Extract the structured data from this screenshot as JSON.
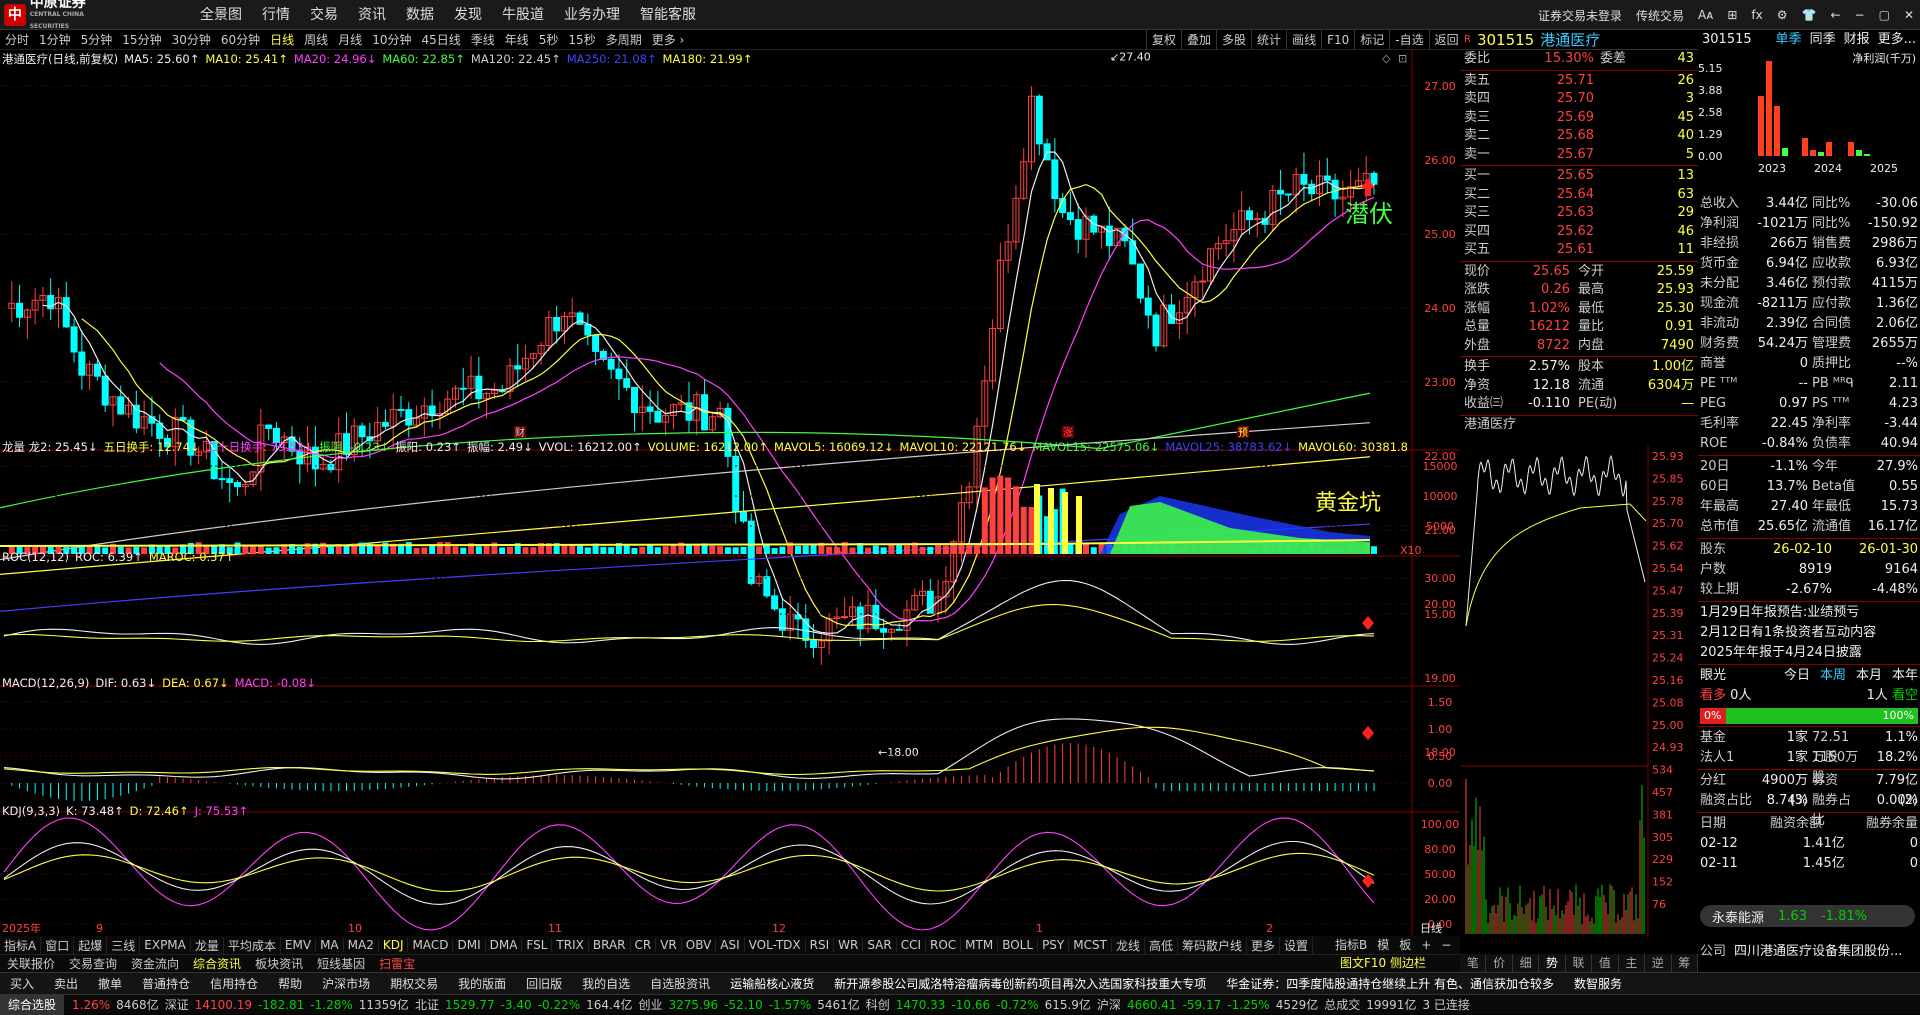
{
  "app": {
    "logo": "中原证券",
    "logo_sub": "CENTRAL CHINA SECURITIES",
    "menu": [
      "全景图",
      "行情",
      "交易",
      "资讯",
      "数据",
      "发现",
      "牛股道",
      "业务办理",
      "智能客服"
    ],
    "right": [
      "证券交易未登录",
      "传统交易",
      "Aᴀ",
      "⊞",
      "fx",
      "⚙",
      "👕",
      "←",
      "−",
      "▢",
      "✕"
    ]
  },
  "toolbar": {
    "periods": [
      "分时",
      "1分钟",
      "5分钟",
      "15分钟",
      "30分钟",
      "60分钟",
      "日线",
      "周线",
      "月线",
      "10分钟",
      "45日线",
      "季线",
      "年线",
      "5秒",
      "15秒",
      "多周期",
      "更多 ›"
    ],
    "active": "日线",
    "right": [
      "复权",
      "叠加",
      "多股",
      "统计",
      "画线",
      "F10",
      "标记",
      "-自选",
      "返回"
    ]
  },
  "chart": {
    "title": "港通医疗(日线,前复权)",
    "ma": [
      {
        "label": "MA5: 25.60↑",
        "color": "#eeeeee"
      },
      {
        "label": "MA10: 25.41↑",
        "color": "#ffff40"
      },
      {
        "label": "MA20: 24.96↓",
        "color": "#ff40ff"
      },
      {
        "label": "MA60: 22.85↑",
        "color": "#40ff40"
      },
      {
        "label": "MA120: 22.45↑",
        "color": "#cccccc"
      },
      {
        "label": "MA250: 21.08↑",
        "color": "#4040ff"
      },
      {
        "label": "MA180: 21.99↑",
        "color": "#ffff40"
      }
    ],
    "yticks": [
      "27.00",
      "26.00",
      "25.00",
      "24.00",
      "23.00",
      "22.00",
      "21.00",
      "20.00",
      "19.00",
      "18.00"
    ],
    "high_label": "27.40",
    "low_label": "18.00",
    "annot_qianfu": "潜伏",
    "annot_gold": "黄金坑",
    "markers": [
      "财",
      "涨",
      "预"
    ],
    "months": [
      "2025年",
      "9",
      "10",
      "11",
      "12",
      "1",
      "2"
    ],
    "period_label": "日线"
  },
  "vol": {
    "legend": [
      {
        "t": "龙量 龙2: 25.45↓",
        "c": "#eeeeee"
      },
      {
        "t": "五日换手: 12.74↓",
        "c": "#ffff40"
      },
      {
        "t": "二十日换手: 79.53↓",
        "c": "#ff40ff"
      },
      {
        "t": "振阴: -0.23↓",
        "c": "#40ff40"
      },
      {
        "t": "振阳: 0.23↑",
        "c": "#eeeeee"
      },
      {
        "t": "振幅: 2.49↓",
        "c": "#eeeeee"
      },
      {
        "t": "VVOL: 16212.00↑",
        "c": "#eeeeee"
      },
      {
        "t": "VOLUME: 16212.00↑",
        "c": "#ffff40"
      },
      {
        "t": "MAVOL5: 16069.12↓",
        "c": "#ffff40"
      },
      {
        "t": "MAVOL10: 22121.76↓",
        "c": "#ffff40"
      },
      {
        "t": "MAVOL15: 22575.06↓",
        "c": "#40ff40"
      },
      {
        "t": "MAVOL25: 38783.62↓",
        "c": "#4040ff"
      },
      {
        "t": "MAVOL60: 30381.8",
        "c": "#ffff40"
      }
    ],
    "yticks": [
      "15000",
      "10000",
      "5000"
    ],
    "unit": "X10"
  },
  "roc": {
    "legend": [
      {
        "t": "ROC(12,12)",
        "c": "#eeeeee"
      },
      {
        "t": "ROC: 6.39↑",
        "c": "#eeeeee"
      },
      {
        "t": "MAROC: 0.37↑",
        "c": "#ffff40"
      }
    ],
    "yticks": [
      "30.00",
      "15.00"
    ]
  },
  "macd": {
    "legend": [
      {
        "t": "MACD(12,26,9)",
        "c": "#eeeeee"
      },
      {
        "t": "DIF: 0.63↓",
        "c": "#eeeeee"
      },
      {
        "t": "DEA: 0.67↓",
        "c": "#ffff40"
      },
      {
        "t": "MACD: -0.08↓",
        "c": "#ff40ff"
      }
    ],
    "yticks": [
      "1.50",
      "1.00",
      "0.50",
      "0.00"
    ]
  },
  "kdj": {
    "legend": [
      {
        "t": "KDJ(9,3,3)",
        "c": "#eeeeee"
      },
      {
        "t": "K: 73.48↑",
        "c": "#eeeeee"
      },
      {
        "t": "D: 72.46↑",
        "c": "#ffff40"
      },
      {
        "t": "J: 75.53↑",
        "c": "#ff40ff"
      }
    ],
    "yticks": [
      "100.00",
      "80.00",
      "50.00",
      "20.00",
      "0.00"
    ]
  },
  "quote": {
    "code": "301515",
    "name": "港通医疗",
    "webi": "15.30%",
    "weicha": "43",
    "sells": [
      {
        "l": "卖五",
        "p": "25.71",
        "v": "26"
      },
      {
        "l": "卖四",
        "p": "25.70",
        "v": "3"
      },
      {
        "l": "卖三",
        "p": "25.69",
        "v": "45"
      },
      {
        "l": "卖二",
        "p": "25.68",
        "v": "40"
      },
      {
        "l": "卖一",
        "p": "25.67",
        "v": "5"
      }
    ],
    "buys": [
      {
        "l": "买一",
        "p": "25.65",
        "v": "13"
      },
      {
        "l": "买二",
        "p": "25.64",
        "v": "63"
      },
      {
        "l": "买三",
        "p": "25.63",
        "v": "29"
      },
      {
        "l": "买四",
        "p": "25.62",
        "v": "46"
      },
      {
        "l": "买五",
        "p": "25.61",
        "v": "11"
      }
    ],
    "stats": [
      [
        "现价",
        "25.65",
        "今开",
        "25.59"
      ],
      [
        "涨跌",
        "0.26",
        "最高",
        "25.93"
      ],
      [
        "涨幅",
        "1.02%",
        "最低",
        "25.30"
      ],
      [
        "总量",
        "16212",
        "量比",
        "0.91"
      ],
      [
        "外盘",
        "8722",
        "内盘",
        "7490"
      ]
    ],
    "stats2": [
      [
        "换手",
        "2.57%",
        "股本",
        "1.00亿"
      ],
      [
        "净资",
        "12.18",
        "流通",
        "6304万"
      ],
      [
        "收益㈢",
        "-0.110",
        "PE(动)",
        "—"
      ]
    ],
    "mini_title": "港通医疗",
    "mini_ticks": [
      "25.93",
      "25.85",
      "25.78",
      "25.70",
      "25.62",
      "25.54",
      "25.47",
      "25.39",
      "25.31",
      "25.24",
      "25.16",
      "25.08",
      "25.00",
      "24.93",
      "534",
      "457",
      "381",
      "305",
      "229",
      "152",
      "76"
    ],
    "tabs": [
      "笔",
      "价",
      "细",
      "势",
      "联",
      "值",
      "主",
      "逆",
      "筹"
    ]
  },
  "fin": {
    "code": "301515",
    "tabs": [
      "单季",
      "同季",
      "财报",
      "更多..."
    ],
    "chart_title": "净利润(千万)",
    "chart_ticks": [
      "5.15",
      "3.88",
      "2.58",
      "1.29",
      "0.00"
    ],
    "years": [
      "2023",
      "2024",
      "2025"
    ],
    "rows": [
      [
        "总收入",
        "3.44亿",
        "同比%",
        "-30.06"
      ],
      [
        "净利润",
        "-1021万",
        "同比%",
        "-150.92"
      ],
      [
        "非经损",
        "266万",
        "销售费",
        "2986万"
      ],
      [
        "货币金",
        "6.94亿",
        "应收款",
        "6.93亿"
      ],
      [
        "未分配",
        "3.46亿",
        "预付款",
        "4115万"
      ],
      [
        "现金流",
        "-8211万",
        "应付款",
        "1.36亿"
      ],
      [
        "非流动",
        "2.39亿",
        "合同债",
        "2.06亿"
      ],
      [
        "财务费",
        "54.24万",
        "管理费",
        "2655万"
      ],
      [
        "商誉",
        "0",
        "质押比",
        "--%"
      ],
      [
        "PE ᵀᵀᴹ",
        "--",
        "PB ᴹᴿᑫ",
        "2.11"
      ],
      [
        "PEG",
        "0.97",
        "PS ᵀᵀᴹ",
        "4.23"
      ],
      [
        "毛利率",
        "22.45",
        "净利率",
        "-3.44"
      ],
      [
        "ROE",
        "-0.84%",
        "负债率",
        "40.94"
      ]
    ],
    "rows2": [
      [
        "20日",
        "-1.1%",
        "今年",
        "27.9%"
      ],
      [
        "60日",
        "13.7%",
        "Beta值",
        "0.55"
      ],
      [
        "年最高",
        "27.40",
        "年最低",
        "15.73"
      ],
      [
        "总市值",
        "25.65亿",
        "流通值",
        "16.17亿"
      ]
    ],
    "holders": [
      [
        "股东",
        "26-02-10",
        "26-01-30"
      ],
      [
        "户数",
        "8919",
        "9164"
      ],
      [
        "较上期",
        "-2.67%",
        "-4.48%"
      ]
    ],
    "news": [
      "1月29日年报预告:业绩预亏",
      "2月12日有1条投资者互动内容",
      "2025年年报于4月24日披露"
    ],
    "eye": {
      "label": "眼光",
      "tabs": [
        "今日",
        "本周",
        "本月",
        "本年"
      ],
      "bull": "看多",
      "bull_n": "0人",
      "bear_n": "1人",
      "bear": "看空",
      "pct_l": "0%",
      "pct_r": "100%"
    },
    "inst": [
      [
        "基金",
        "1家",
        "72.51万股",
        "1.1%"
      ],
      [
        "法人1",
        "1家",
        "1150万股",
        "18.2%"
      ]
    ],
    "div": [
      [
        "分红",
        "4900万(3)",
        "募资",
        "7.79亿(2)"
      ],
      [
        "融资占比",
        "8.74%",
        "融券占比",
        "0.00%"
      ]
    ],
    "margin_head": [
      "日期",
      "融资余额",
      "融券余量"
    ],
    "margin": [
      [
        "02-12",
        "1.41亿",
        "0"
      ],
      [
        "02-11",
        "1.45亿",
        "0"
      ]
    ],
    "float": {
      "name": "永泰能源",
      "price": "1.63",
      "chg": "-1.81%"
    },
    "company": [
      "公司",
      "四川港通医疗设备集团股份..."
    ]
  },
  "bottomtabs": [
    "指标A",
    "窗口",
    "起爆",
    "三线",
    "EXPMA",
    "龙量",
    "平均成本",
    "EMV",
    "MA",
    "MA2",
    "KDJ",
    "MACD",
    "DMI",
    "DMA",
    "FSL",
    "TRIX",
    "BRAR",
    "CR",
    "VR",
    "OBV",
    "ASI",
    "VOL-TDX",
    "RSI",
    "WR",
    "SAR",
    "CCI",
    "ROC",
    "MTM",
    "BOLL",
    "PSY",
    "MCST",
    "龙线",
    "高低",
    "筹码散户线",
    "更多",
    "设置"
  ],
  "bottomright": [
    "指标B",
    "模",
    "板",
    "+",
    "−"
  ],
  "navrow": [
    "关联报价",
    "交易查询",
    "资金流向",
    "综合资讯",
    "板块资讯",
    "短线基因",
    "扫雷宝"
  ],
  "nav_right": "图文F10 侧边栏",
  "actrow": [
    "买入",
    "卖出",
    "撤单",
    "普通持仓",
    "信用持仓",
    "帮助",
    "沪深市场",
    "期权交易",
    "我的版面",
    "回旧版",
    "我的自选",
    "自选股资讯",
    "运输船核心液货",
    "新开源参股公司威洛特溶瘤病毒创新药项目再次入选国家科技重大专项",
    "华金证券：四季度陆股通持仓继续上升 有色、通信获加仓较多",
    "数智服务"
  ],
  "status": {
    "label": "综合选股",
    "items": [
      {
        "t": "1.26%",
        "c": "#ff4040"
      },
      {
        "t": "8468亿",
        "c": "#ccc"
      },
      {
        "t": "深证",
        "c": "#ccc"
      },
      {
        "t": "14100.19",
        "c": "#ff4040"
      },
      {
        "t": "-182.81",
        "c": "#00d000"
      },
      {
        "t": "-1.28%",
        "c": "#00d000"
      },
      {
        "t": "11359亿",
        "c": "#ccc"
      },
      {
        "t": "北证",
        "c": "#ccc"
      },
      {
        "t": "1529.77",
        "c": "#00d000"
      },
      {
        "t": "-3.40",
        "c": "#00d000"
      },
      {
        "t": "-0.22%",
        "c": "#00d000"
      },
      {
        "t": "164.4亿",
        "c": "#ccc"
      },
      {
        "t": "创业",
        "c": "#ccc"
      },
      {
        "t": "3275.96",
        "c": "#00d000"
      },
      {
        "t": "-52.10",
        "c": "#00d000"
      },
      {
        "t": "-1.57%",
        "c": "#00d000"
      },
      {
        "t": "5461亿",
        "c": "#ccc"
      },
      {
        "t": "科创",
        "c": "#ccc"
      },
      {
        "t": "1470.33",
        "c": "#00d000"
      },
      {
        "t": "-10.66",
        "c": "#00d000"
      },
      {
        "t": "-0.72%",
        "c": "#00d000"
      },
      {
        "t": "615.9亿",
        "c": "#ccc"
      },
      {
        "t": "沪深",
        "c": "#ccc"
      },
      {
        "t": "4660.41",
        "c": "#00d000"
      },
      {
        "t": "-59.17",
        "c": "#00d000"
      },
      {
        "t": "-1.25%",
        "c": "#00d000"
      },
      {
        "t": "4529亿",
        "c": "#ccc"
      },
      {
        "t": "总成交",
        "c": "#ccc"
      },
      {
        "t": "19991亿",
        "c": "#ccc"
      },
      {
        "t": "3 已连接",
        "c": "#ccc"
      }
    ]
  }
}
